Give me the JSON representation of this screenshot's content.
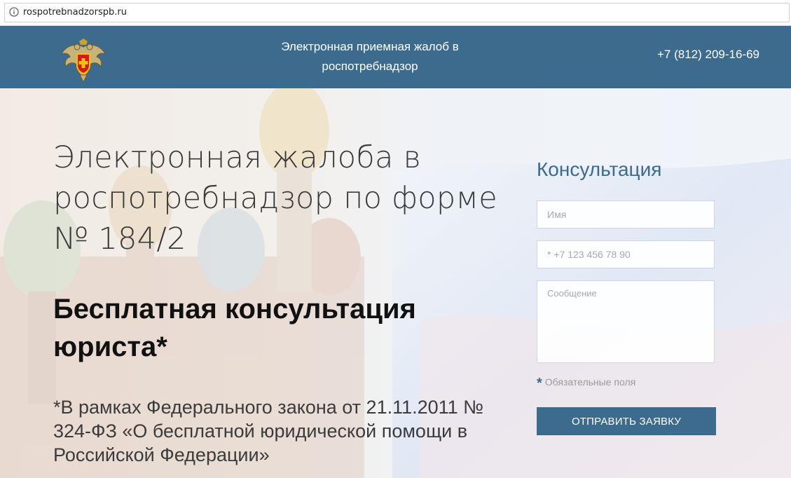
{
  "browser": {
    "url": "rospotrebnadzorspb.ru",
    "info_icon": "info-circle-icon"
  },
  "header": {
    "logo_icon": "double-headed-eagle-emblem",
    "title": "Электронная приемная жалоб в роспотребнадзор",
    "phone": "+7 (812) 209-16-69",
    "background_color": "#3d6b8e"
  },
  "hero": {
    "title": "Электронная жалоба в роспотребнадзор по форме № 184/2",
    "subtitle": "Бесплатная консультация юриста*",
    "note": "*В рамках Федерального закона от 21.11.2011 № 324-ФЗ «О бесплатной юридической помощи в Российской Федерации»"
  },
  "form": {
    "title": "Консультация",
    "name_placeholder": "Имя",
    "phone_placeholder": "* +7 123 456 78 90",
    "message_placeholder": "Сообщение",
    "required_star": "*",
    "required_label": "Обязательные поля",
    "submit_label": "ОТПРАВИТЬ ЗАЯВКУ",
    "accent_color": "#3d6b8e"
  }
}
